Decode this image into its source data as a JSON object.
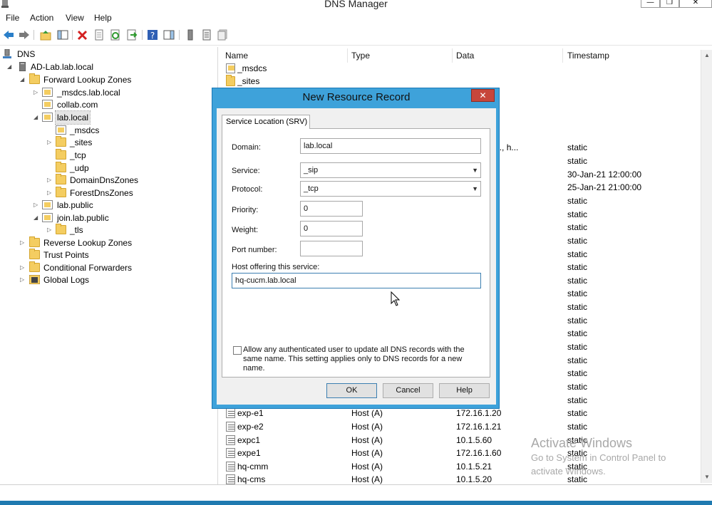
{
  "window": {
    "title": "DNS Manager",
    "controls": {
      "minimize": "—",
      "maximize": "❐",
      "close": "✕"
    }
  },
  "menu": [
    "File",
    "Action",
    "View",
    "Help"
  ],
  "toolbar": [
    "back-arrow-icon",
    "forward-arrow-icon",
    "up-folder-icon",
    "show-hide-console-tree-icon",
    "delete-icon",
    "properties-icon",
    "refresh-icon",
    "export-list-icon",
    "help-icon",
    "show-action-pane-icon",
    "update-server-data-icon",
    "new-host-icon",
    "new-alias-icon"
  ],
  "tree": {
    "items": [
      {
        "label": "DNS",
        "icon": "dns-icon",
        "expander": ""
      },
      {
        "label": "AD-Lab.lab.local",
        "icon": "server-icon",
        "expander": "◢"
      },
      {
        "label": "Forward Lookup Zones",
        "icon": "folder-icon",
        "expander": "◢"
      },
      {
        "label": "_msdcs.lab.local",
        "icon": "zone-icon",
        "expander": "▷"
      },
      {
        "label": "collab.com",
        "icon": "zone-icon",
        "expander": ""
      },
      {
        "label": "lab.local",
        "icon": "zone-icon",
        "expander": "◢"
      },
      {
        "label": "_msdcs",
        "icon": "zone-icon",
        "expander": ""
      },
      {
        "label": "_sites",
        "icon": "folder-icon",
        "expander": "▷"
      },
      {
        "label": "_tcp",
        "icon": "folder-icon",
        "expander": ""
      },
      {
        "label": "_udp",
        "icon": "folder-icon",
        "expander": ""
      },
      {
        "label": "DomainDnsZones",
        "icon": "folder-icon",
        "expander": "▷"
      },
      {
        "label": "ForestDnsZones",
        "icon": "folder-icon",
        "expander": "▷"
      },
      {
        "label": "lab.public",
        "icon": "zone-icon",
        "expander": "▷"
      },
      {
        "label": "join.lab.public",
        "icon": "zone-icon",
        "expander": "◢"
      },
      {
        "label": "_tls",
        "icon": "folder-icon",
        "expander": "▷"
      },
      {
        "label": "Reverse Lookup Zones",
        "icon": "folder-icon",
        "expander": "▷"
      },
      {
        "label": "Trust Points",
        "icon": "folder-icon",
        "expander": ""
      },
      {
        "label": "Conditional Forwarders",
        "icon": "folder-icon",
        "expander": "▷"
      },
      {
        "label": "Global Logs",
        "icon": "log-icon",
        "expander": "▷"
      }
    ]
  },
  "list": {
    "columns": [
      "Name",
      "Type",
      "Data",
      "Timestamp"
    ],
    "rows": [
      {
        "name": "_msdcs",
        "type": "",
        "data": "",
        "timestamp": "",
        "icon": "zone-icon"
      },
      {
        "name": "_sites",
        "type": "",
        "data": "",
        "timestamp": "",
        "icon": "folder-icon"
      },
      {
        "name": "",
        "type": "",
        "data": "",
        "timestamp": "",
        "icon": ""
      },
      {
        "name": "",
        "type": "",
        "data": "",
        "timestamp": "",
        "icon": ""
      },
      {
        "name": "",
        "type": "",
        "data": "",
        "timestamp": "",
        "icon": ""
      },
      {
        "name": "",
        "type": "",
        "data": "",
        "timestamp": "",
        "icon": ""
      },
      {
        "name": "",
        "type": "",
        "data": "ab.lab.local., h...",
        "timestamp": "static",
        "icon": ""
      },
      {
        "name": "",
        "type": "",
        "data": "ocal.",
        "timestamp": "static",
        "icon": ""
      },
      {
        "name": "",
        "type": "",
        "data": "",
        "timestamp": "30-Jan-21 12:00:00",
        "icon": ""
      },
      {
        "name": "",
        "type": "",
        "data": "",
        "timestamp": "25-Jan-21 21:00:00",
        "icon": ""
      },
      {
        "name": "",
        "type": "",
        "data": "",
        "timestamp": "static",
        "icon": ""
      },
      {
        "name": "",
        "type": "",
        "data": "",
        "timestamp": "static",
        "icon": ""
      },
      {
        "name": "",
        "type": "",
        "data": "",
        "timestamp": "static",
        "icon": ""
      },
      {
        "name": "",
        "type": "",
        "data": "",
        "timestamp": "static",
        "icon": ""
      },
      {
        "name": "",
        "type": "",
        "data": "",
        "timestamp": "static",
        "icon": ""
      },
      {
        "name": "",
        "type": "",
        "data": "",
        "timestamp": "static",
        "icon": ""
      },
      {
        "name": "",
        "type": "",
        "data": "",
        "timestamp": "static",
        "icon": ""
      },
      {
        "name": "",
        "type": "",
        "data": "",
        "timestamp": "static",
        "icon": ""
      },
      {
        "name": "",
        "type": "",
        "data": "",
        "timestamp": "static",
        "icon": ""
      },
      {
        "name": "",
        "type": "",
        "data": "",
        "timestamp": "static",
        "icon": ""
      },
      {
        "name": "",
        "type": "",
        "data": "",
        "timestamp": "static",
        "icon": ""
      },
      {
        "name": "",
        "type": "",
        "data": "",
        "timestamp": "static",
        "icon": ""
      },
      {
        "name": "",
        "type": "",
        "data": "",
        "timestamp": "static",
        "icon": ""
      },
      {
        "name": "",
        "type": "",
        "data": "",
        "timestamp": "static",
        "icon": ""
      },
      {
        "name": "",
        "type": "",
        "data": "",
        "timestamp": "static",
        "icon": ""
      },
      {
        "name": "",
        "type": "",
        "data": "",
        "timestamp": "static",
        "icon": ""
      },
      {
        "name": "exp-e1",
        "type": "Host (A)",
        "data": "172.16.1.20",
        "timestamp": "static",
        "icon": "record-icon"
      },
      {
        "name": "exp-e2",
        "type": "Host (A)",
        "data": "172.16.1.21",
        "timestamp": "static",
        "icon": "record-icon"
      },
      {
        "name": "expc1",
        "type": "Host (A)",
        "data": "10.1.5.60",
        "timestamp": "static",
        "icon": "record-icon"
      },
      {
        "name": "expe1",
        "type": "Host (A)",
        "data": "172.16.1.60",
        "timestamp": "static",
        "icon": "record-icon"
      },
      {
        "name": "hq-cmm",
        "type": "Host (A)",
        "data": "10.1.5.21",
        "timestamp": "static",
        "icon": "record-icon"
      },
      {
        "name": "hq-cms",
        "type": "Host (A)",
        "data": "10.1.5.20",
        "timestamp": "static",
        "icon": "record-icon"
      }
    ]
  },
  "watermark": {
    "title": "Activate Windows",
    "line1": "Go to System in Control Panel to",
    "line2": "activate Windows."
  },
  "dialog": {
    "title": "New Resource Record",
    "close": "✕",
    "tab": "Service Location (SRV)",
    "domain_label": "Domain:",
    "domain_value": "lab.local",
    "service_label": "Service:",
    "service_value": "_sip",
    "protocol_label": "Protocol:",
    "protocol_value": "_tcp",
    "priority_label": "Priority:",
    "priority_value": "0",
    "weight_label": "Weight:",
    "weight_value": "0",
    "port_label": "Port number:",
    "port_value": "",
    "host_label": "Host offering this service:",
    "host_value": "hq-cucm.lab.local",
    "checkbox_label": "Allow any authenticated user to update all DNS records with the same name. This setting applies only to DNS records for a new name.",
    "checkbox_checked": false,
    "ok": "OK",
    "cancel": "Cancel",
    "help": "Help"
  }
}
